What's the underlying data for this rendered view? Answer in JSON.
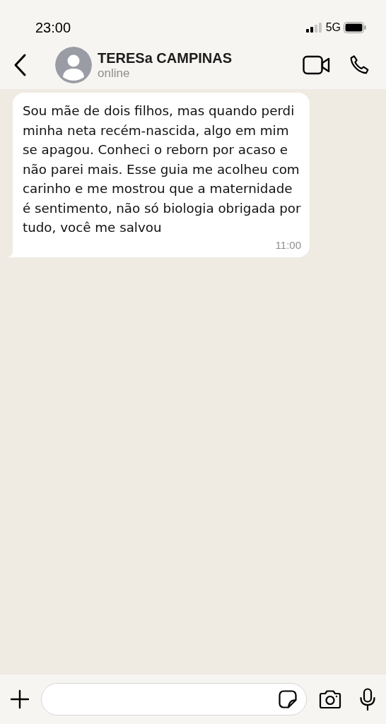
{
  "status_bar": {
    "time": "23:00",
    "network": "5G"
  },
  "header": {
    "contact_name": "TERESa CAMPINAS",
    "presence": "online"
  },
  "messages": [
    {
      "kind": "incoming",
      "text": "Sou mãe de dois filhos, mas quando perdi minha neta recém-nascida, algo em mim se apagou. Conheci o reborn por acaso e não parei mais. Esse guia me acolheu com carinho e me mostrou que a maternidade é sentimento, não só biologia obrigada por tudo, você me salvou",
      "time": "11:00"
    }
  ]
}
